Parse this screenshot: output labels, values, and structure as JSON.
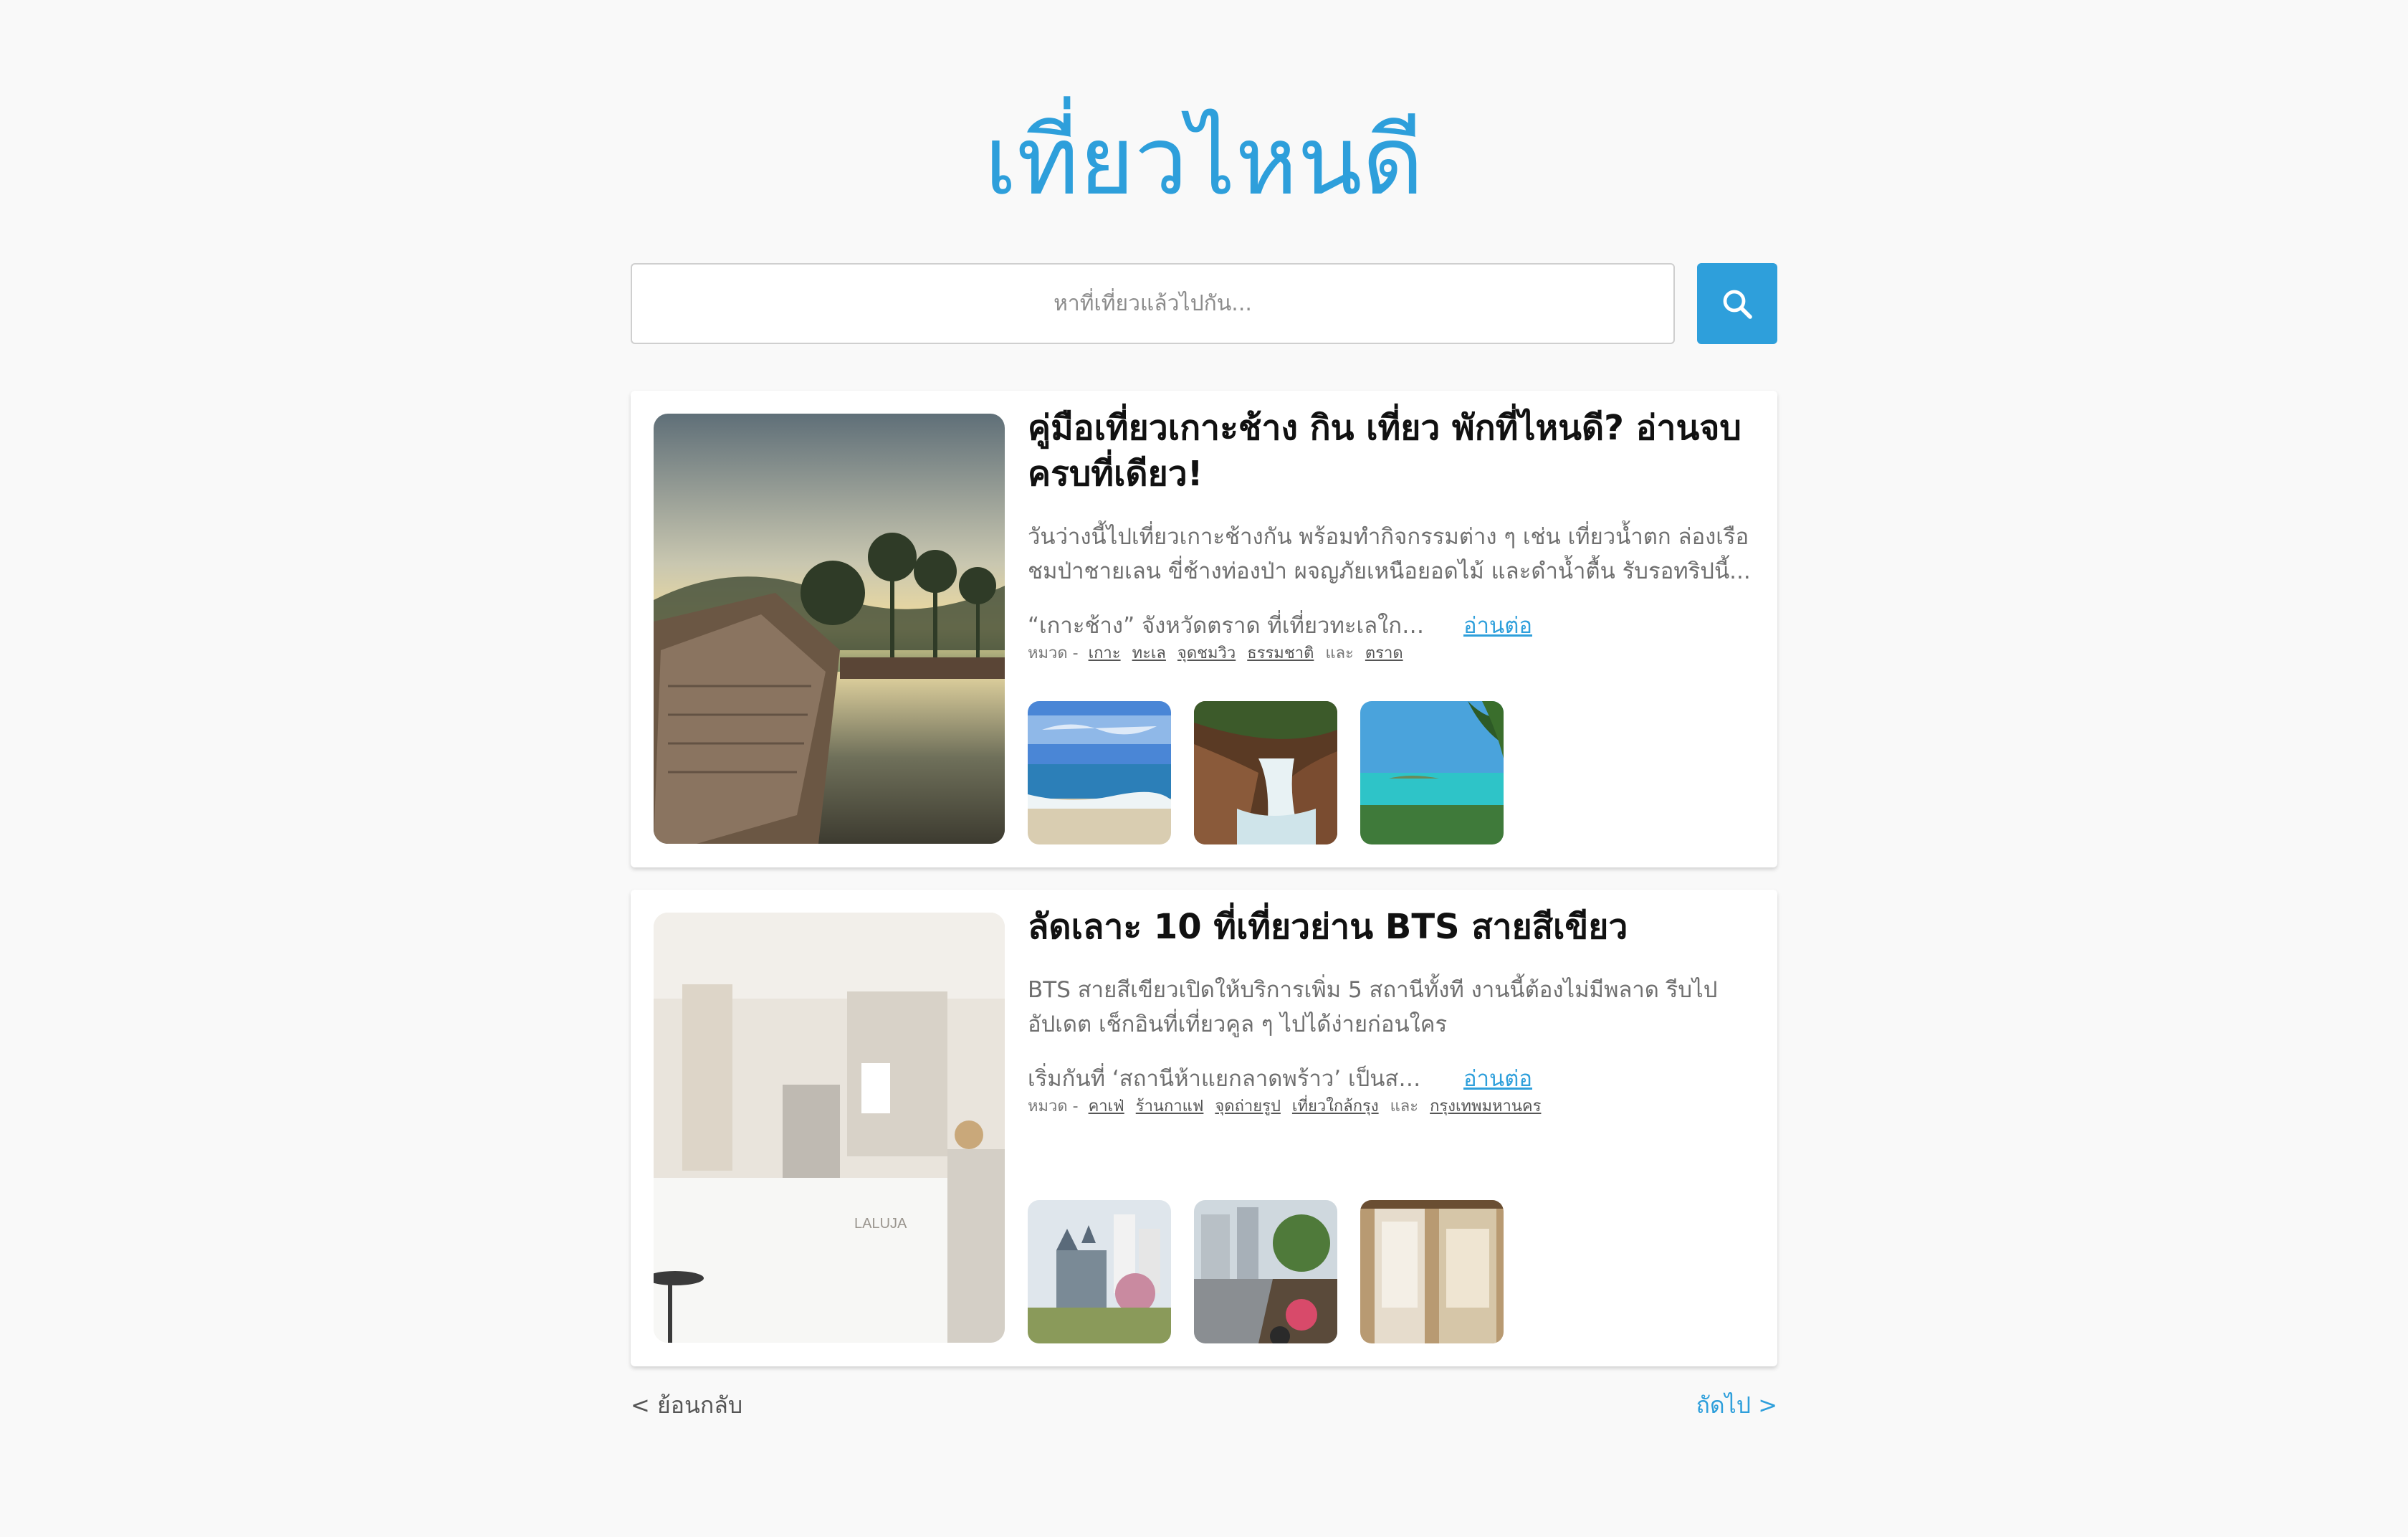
{
  "site": {
    "title": "เที่ยวไหนดี",
    "accent_color": "#2e9fdb"
  },
  "search": {
    "placeholder": "หาที่เที่ยวแล้วไปกัน...",
    "value": "",
    "button_icon": "search-icon"
  },
  "articles": [
    {
      "title": "คู่มือเที่ยวเกาะช้าง กิน เที่ยว พักที่ไหนดี? อ่านจบครบที่เดียว!",
      "description": "วันว่างนี้ไปเที่ยวเกาะช้างกัน พร้อมทำกิจกรรมต่าง ๆ เช่น เที่ยวน้ำตก ล่องเรือชมป่าชายเลน ขี่ช้างท่องป่า ผจญภัยเหนือยอดไม้ และดำน้ำตื้น รับรอทริปนี้...",
      "excerpt": "“เกาะช้าง” จังหวัดตราด ที่เที่ยวทะเลใกล้กรุงเทพฯ",
      "read_more": "อ่านต่อ",
      "category_label": "หมวด -",
      "categories": [
        "เกาะ",
        "ทะเล",
        "จุดชมวิว",
        "ธรรมชาติ"
      ],
      "category_last": "ตราด",
      "and_word": "และ",
      "image": "resort-pool-sunset-photo",
      "thumbs": [
        "beach-photo",
        "waterfall-photo",
        "tropical-sea-photo"
      ]
    },
    {
      "title": "ลัดเลาะ 10 ที่เที่ยวย่าน BTS สายสีเขียว",
      "description": "BTS สายสีเขียวเปิดให้บริการเพิ่ม 5 สถานีทั้งที งานนี้ต้องไม่มีพลาด รีบไปอัปเดต เช็กอินที่เที่ยวคูล ๆ ไปได้ง่ายก่อนใคร",
      "excerpt": "เริ่มกันที่ ‘สถานีห้าแยกลาดพร้าว’ เป็นสถานีแรก",
      "read_more": "อ่านต่อ",
      "category_label": "หมวด -",
      "categories": [
        "คาเฟ่",
        "ร้านกาแฟ",
        "จุดถ่ายรูป",
        "เที่ยวใกล้กรุง"
      ],
      "category_last": "กรุงเทพมหานคร",
      "and_word": "และ",
      "image": "white-cafe-interior-photo",
      "thumbs": [
        "castle-park-photo",
        "street-market-photo",
        "shop-front-photo"
      ]
    }
  ],
  "pagination": {
    "prev": "< ย้อนกลับ",
    "next": "ถัดไป >"
  }
}
